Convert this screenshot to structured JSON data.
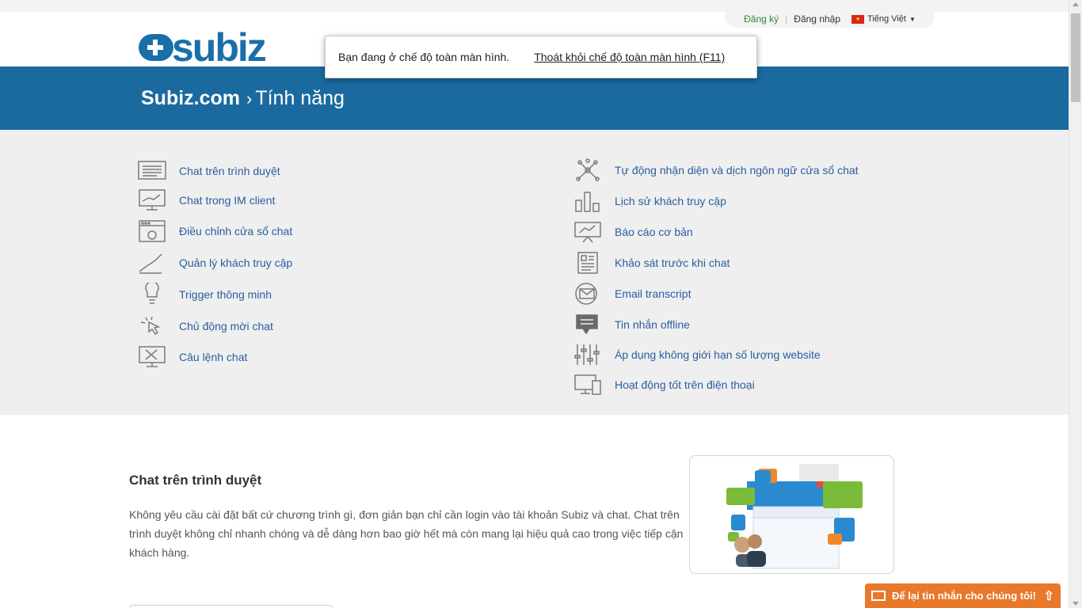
{
  "top_links": {
    "register": "Đăng ký",
    "login": "Đăng nhập",
    "language": "Tiếng Việt"
  },
  "logo": {
    "text": "subiz"
  },
  "fullscreen_notice": {
    "message": "Bạn đang ở chế độ toàn màn hình.",
    "exit_link": "Thoát khỏi chế độ toàn màn hình (F11)"
  },
  "breadcrumb": {
    "site": "Subiz.com",
    "separator": "›",
    "page": "Tính năng"
  },
  "features_left": [
    {
      "label": "Chat trên trình duyệt",
      "icon": "browser-chat-icon"
    },
    {
      "label": "Chat trong IM client",
      "icon": "monitor-chart-icon"
    },
    {
      "label": "Điều chỉnh cửa sổ chat",
      "icon": "window-settings-icon"
    },
    {
      "label": "Quản lý khách truy cập",
      "icon": "growth-line-icon"
    },
    {
      "label": "Trigger thông minh",
      "icon": "lightbulb-icon"
    },
    {
      "label": "Chủ động mời chat",
      "icon": "pointer-click-icon"
    },
    {
      "label": "Câu lệnh chat",
      "icon": "tools-monitor-icon"
    }
  ],
  "features_right": [
    {
      "label": "Tự động nhận diện và dịch ngôn ngữ cửa sổ chat",
      "icon": "network-nodes-icon"
    },
    {
      "label": "Lịch sử khách truy cập",
      "icon": "bar-chart-icon"
    },
    {
      "label": "Báo cáo cơ bản",
      "icon": "presentation-board-icon"
    },
    {
      "label": "Khảo sát trước khi chat",
      "icon": "document-icon"
    },
    {
      "label": "Email transcript",
      "icon": "email-circle-icon"
    },
    {
      "label": "Tin nhắn offline",
      "icon": "message-bubble-icon"
    },
    {
      "label": "Áp dụng không giới hạn số lượng website",
      "icon": "sliders-icon"
    },
    {
      "label": "Hoạt động tốt trên điện thoại",
      "icon": "devices-icon"
    }
  ],
  "content": {
    "title": "Chat trên trình duyệt",
    "body": "Không yêu cầu cài đặt bất cứ chương trình gì, đơn giản bạn chỉ cần login vào tài khoản Subiz và chat. Chat trên trình duyệt không chỉ nhanh chóng và dễ dàng hơn bao giờ hết mà còn mang lại hiệu quả cao trong việc tiếp cận khách hàng."
  },
  "feedback_bar": {
    "label": "Để lại tin nhắn cho chúng tôi!"
  },
  "colors": {
    "brand_blue": "#1a6aa0",
    "link_blue": "#2a5d9f",
    "feedback_orange": "#e8782a",
    "register_green": "#2e8b3a"
  }
}
